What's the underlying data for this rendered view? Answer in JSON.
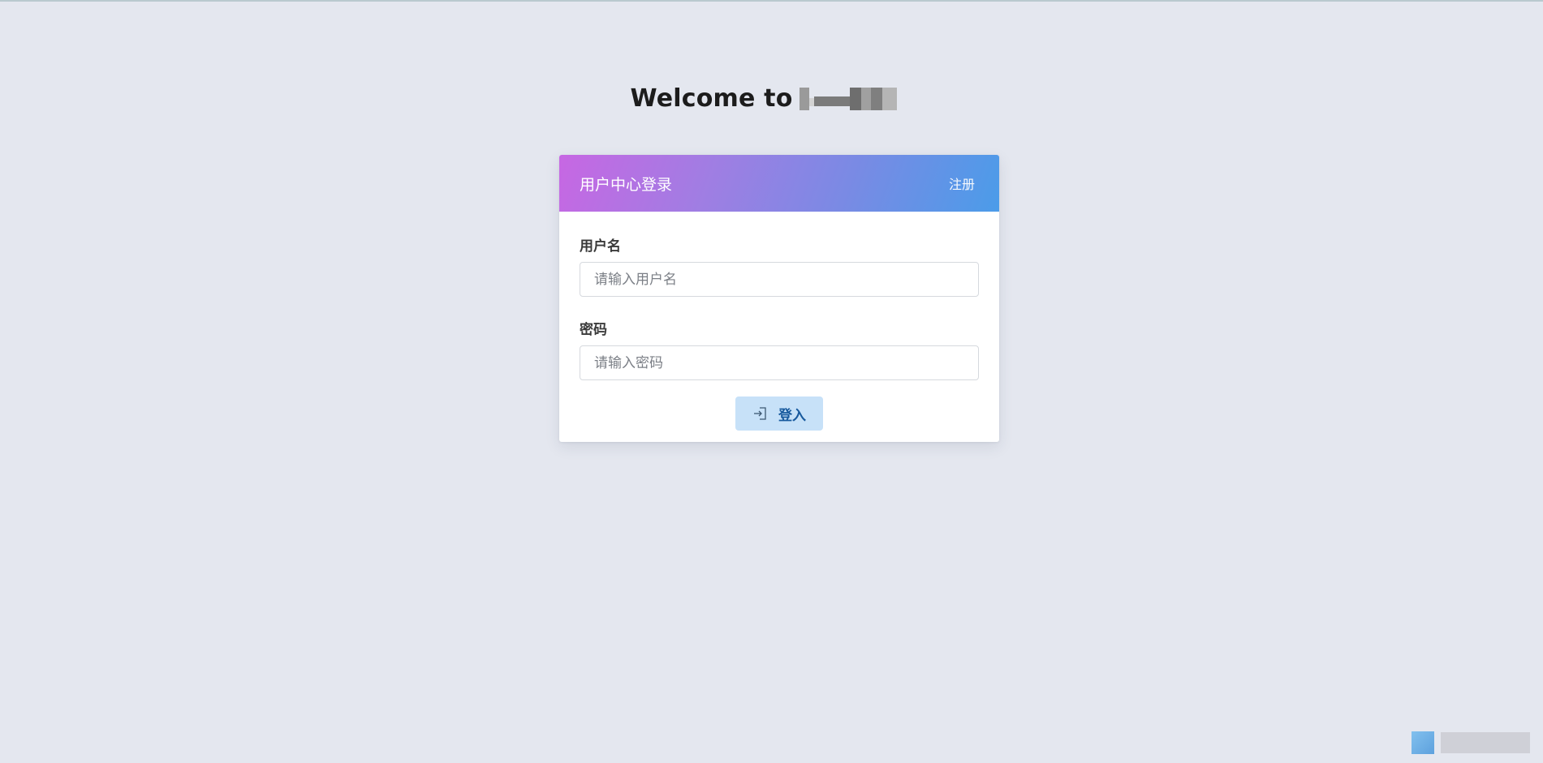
{
  "page": {
    "welcome_text": "Welcome to"
  },
  "login_card": {
    "title": "用户中心登录",
    "register_label": "注册",
    "username": {
      "label": "用户名",
      "placeholder": "请输入用户名",
      "value": ""
    },
    "password": {
      "label": "密码",
      "placeholder": "请输入密码",
      "value": ""
    },
    "login_button_label": "登入",
    "login_icon": "sign-in-icon"
  },
  "colors": {
    "background": "#e4e7ef",
    "header_gradient_start": "#c767e3",
    "header_gradient_end": "#4b9ce9",
    "button_bg": "#c7e1f8",
    "button_text": "#17599d"
  }
}
